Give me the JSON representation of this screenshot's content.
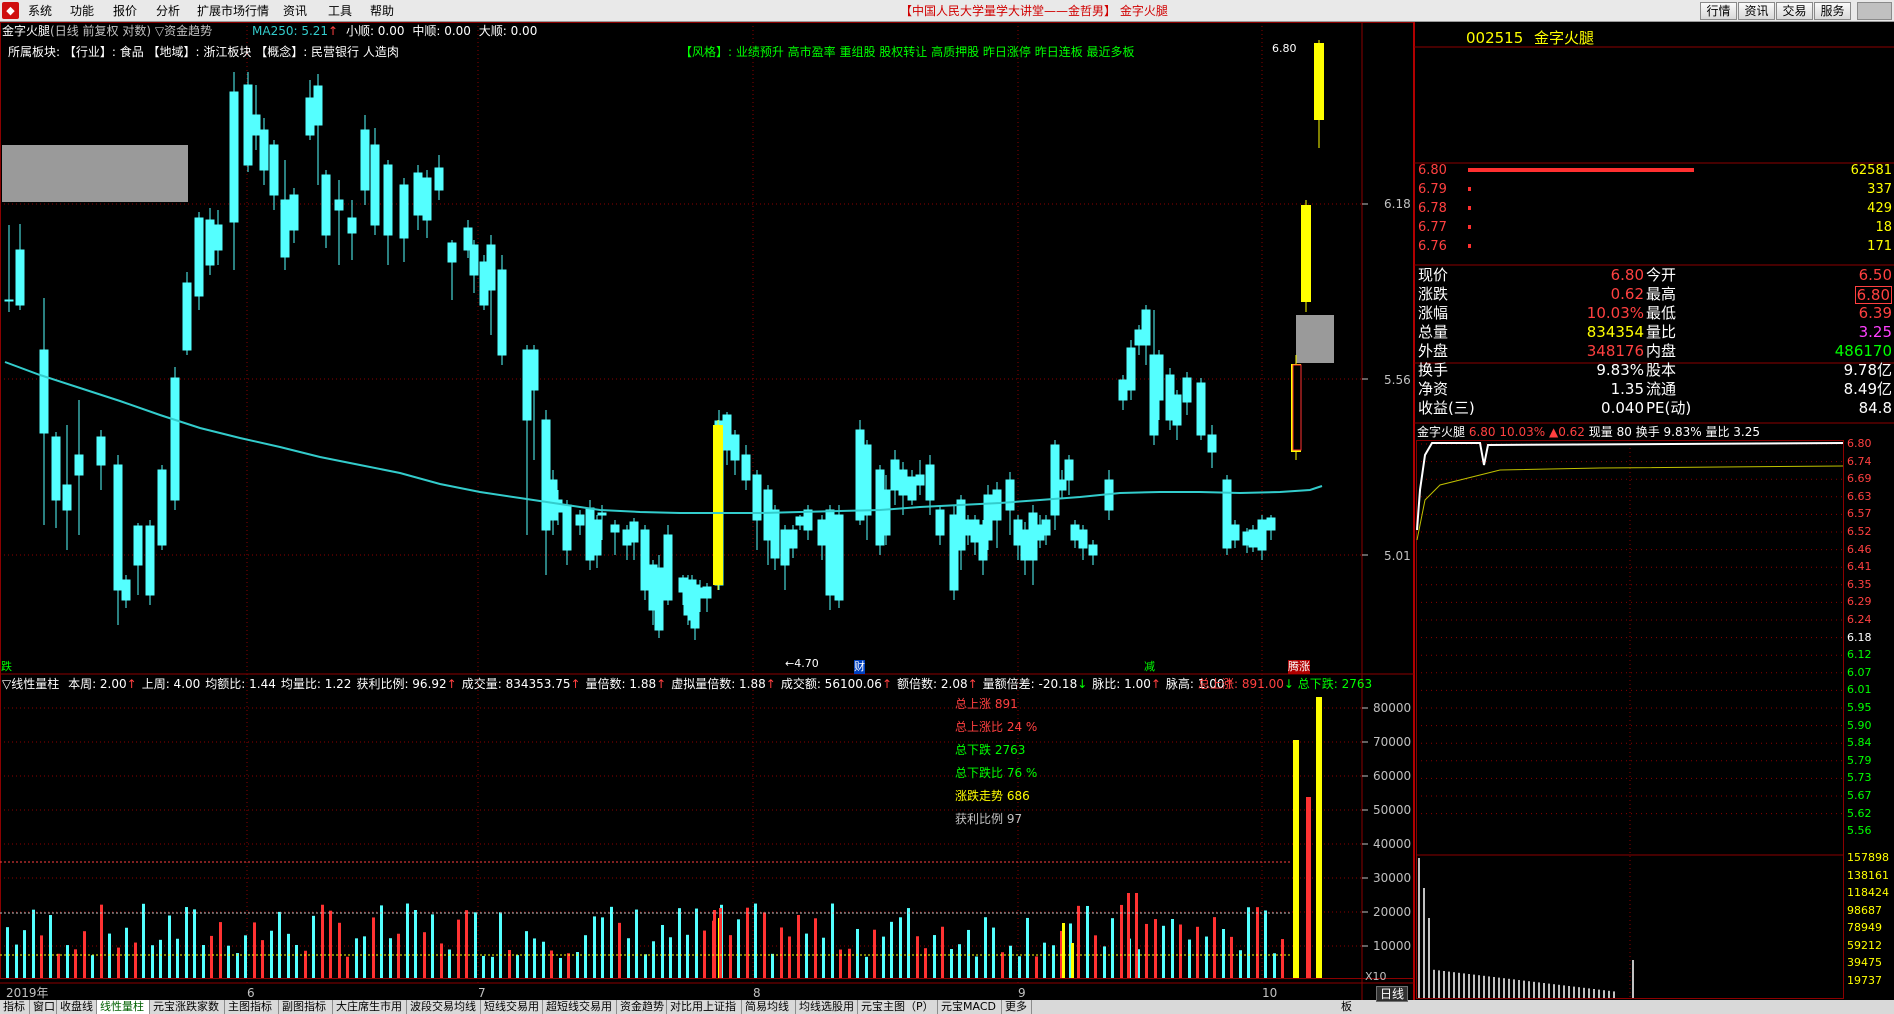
{
  "menu": [
    "系统",
    "功能",
    "报价",
    "分析",
    "扩展市场行情",
    "资讯",
    "工具",
    "帮助"
  ],
  "window_title": "【中国人民大学量学大讲堂——金哲男】 金字火腿",
  "top_buttons": [
    "行情",
    "资讯",
    "交易",
    "服务"
  ],
  "chart_header": {
    "stock_name": "金字火腿",
    "mode": "(日线 前复权 对数)",
    "indicator": "▽资金趋势",
    "ma250": "MA250: 5.21",
    "ma250_arrow": "↑",
    "small_shun": "小顺: 0.00",
    "mid_shun": "中顺: 0.00",
    "big_shun": "大顺: 0.00"
  },
  "sector_line": "所属板块:  【行业】: 食品 【地域】: 浙江板块 【概念】: 民营银行 人造肉",
  "style_line": "【风格】: 业绩预升 高市盈率 重组股 股权转让 高质押股 昨日涨停 昨日连板 最近多板",
  "price_axis": [
    "6.18",
    "5.56",
    "5.01"
  ],
  "labels": {
    "high_label": "6.80",
    "low_label": "←4.70",
    "marker_ji": "跌",
    "marker_cai": "财",
    "marker_jian": "减",
    "marker_tengzhang": "腾涨"
  },
  "vol_header": {
    "title": "▽线性量柱",
    "items": [
      {
        "t": "本周: 2.00",
        "arrow": "↑"
      },
      {
        "t": "上周: 4.00",
        "arrow": ""
      },
      {
        "t": "均额比: 1.44",
        "arrow": ""
      },
      {
        "t": "均量比: 1.22",
        "arrow": ""
      },
      {
        "t": "获利比例: 96.92",
        "arrow": "↑"
      },
      {
        "t": "成交量: 834353.75",
        "arrow": "↑"
      },
      {
        "t": "量倍数: 1.88",
        "arrow": "↑"
      },
      {
        "t": "虚拟量倍数: 1.88",
        "arrow": "↑"
      },
      {
        "t": "成交额: 56100.06",
        "arrow": "↑"
      },
      {
        "t": "额倍数: 2.08",
        "arrow": "↑"
      },
      {
        "t": "量额倍差: -20.18",
        "arrow": "↓"
      },
      {
        "t": "脉比: 1.00",
        "arrow": "↑"
      },
      {
        "t": "脉高: 1.00",
        "arrow": "↑"
      }
    ],
    "total_up": "总上涨: 891.00",
    "total_down": "↓ 总下跌: 2763"
  },
  "vol_stats": {
    "total_up": "总上涨 891",
    "total_up_ratio": "总上涨比 24 %",
    "total_down": "总下跌 2763",
    "total_down_ratio": "总下跌比 76 %",
    "trend": "涨跌走势 686",
    "profit": "获利比例 97"
  },
  "vol_axis": [
    "80000",
    "70000",
    "60000",
    "50000",
    "40000",
    "30000",
    "20000",
    "10000"
  ],
  "vol_unit": "X10",
  "date_axis": {
    "year": "2019年",
    "m6": "6",
    "m7": "7",
    "m8": "8",
    "m9": "9",
    "m10": "10"
  },
  "bottom_tabs": [
    "指标",
    "窗口",
    "收盘线",
    "线性量柱",
    "元宝涨跌家数",
    "主图指标",
    "副图指标",
    "大庄席生市用",
    "波段交易均线",
    "短线交易用",
    "超短线交易用",
    "资金趋势",
    "对比用上证指",
    "简易均线",
    "均线选股用",
    "元宝主图（P）",
    "元宝MACD",
    "更多"
  ],
  "right_panel": {
    "code": "002515",
    "name": "金字火腿",
    "orderbook": [
      {
        "price": "6.80",
        "vol": "62581",
        "bar": 1.0
      },
      {
        "price": "6.79",
        "vol": "337",
        "bar": 0.005
      },
      {
        "price": "6.78",
        "vol": "429",
        "bar": 0.007
      },
      {
        "price": "6.77",
        "vol": "18",
        "bar": 0.001
      },
      {
        "price": "6.76",
        "vol": "171",
        "bar": 0.003
      }
    ],
    "quote": [
      {
        "k1": "现价",
        "v1": "6.80",
        "c1": "#ff4040",
        "k2": "今开",
        "v2": "6.50",
        "c2": "#ff4040"
      },
      {
        "k1": "涨跌",
        "v1": "0.62",
        "c1": "#ff4040",
        "k2": "最高",
        "v2": "6.80",
        "c2": "#ff4040",
        "box2": true
      },
      {
        "k1": "涨幅",
        "v1": "10.03%",
        "c1": "#ff4040",
        "k2": "最低",
        "v2": "6.39",
        "c2": "#ff4040"
      },
      {
        "k1": "总量",
        "v1": "834354",
        "c1": "#ffff00",
        "k2": "量比",
        "v2": "3.25",
        "c2": "#ff40ff"
      },
      {
        "k1": "外盘",
        "v1": "348176",
        "c1": "#ff4040",
        "k2": "内盘",
        "v2": "486170",
        "c2": "#00ff00"
      },
      {
        "k1": "换手",
        "v1": "9.83%",
        "c1": "#ffffff",
        "k2": "股本",
        "v2": "9.78亿",
        "c2": "#ffffff"
      },
      {
        "k1": "净资",
        "v1": "1.35",
        "c1": "#ffffff",
        "k2": "流通",
        "v2": "8.49亿",
        "c2": "#ffffff"
      },
      {
        "k1": "收益(三)",
        "v1": "0.040",
        "c1": "#ffffff",
        "k2": "PE(动)",
        "v2": "84.8",
        "c2": "#ffffff"
      }
    ],
    "mini_header": {
      "name": "金字火腿",
      "price": "6.80",
      "pct": "10.03%",
      "chg": "▲0.62",
      "vol": "现量 80",
      "turn": "换手 9.83%",
      "ratio": "量比 3.25"
    },
    "mini_price_axis": [
      "6.80",
      "6.74",
      "6.69",
      "6.63",
      "6.57",
      "6.52",
      "6.46",
      "6.41",
      "6.35",
      "6.29",
      "6.24",
      "6.18",
      "6.12",
      "6.07",
      "6.01",
      "5.95",
      "5.90",
      "5.84",
      "5.79",
      "5.73",
      "5.67",
      "5.62",
      "5.56"
    ],
    "mini_vol_axis": [
      "157898",
      "138161",
      "118424",
      "98687",
      "78949",
      "59212",
      "39475",
      "19737"
    ],
    "daily_label": "日线",
    "board_label": "板"
  },
  "colors": {
    "up": "#ff3232",
    "down": "#54ffff",
    "ma": "#33cccc",
    "limit": "#ffff00",
    "grid": "#8b0000"
  }
}
